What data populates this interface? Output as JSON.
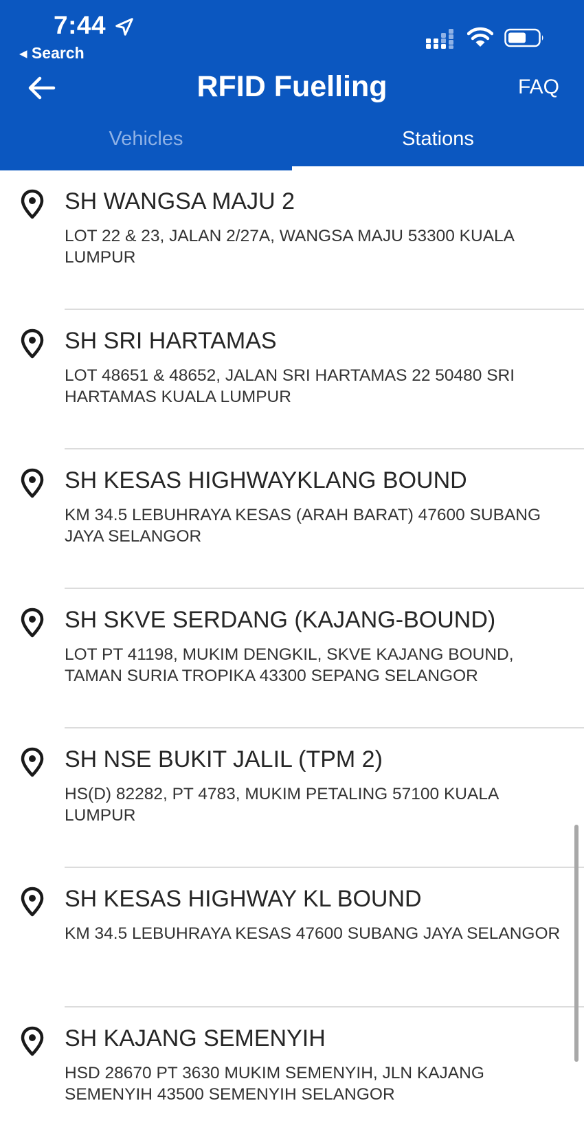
{
  "status_bar": {
    "time": "7:44",
    "back_app": "◂ Search"
  },
  "header": {
    "title": "RFID Fuelling",
    "faq_label": "FAQ",
    "brand_color": "#0b57c0"
  },
  "tabs": [
    {
      "label": "Vehicles",
      "active": false
    },
    {
      "label": "Stations",
      "active": true
    }
  ],
  "stations": [
    {
      "name": "SH WANGSA MAJU 2",
      "address": "LOT 22 & 23, JALAN 2/27A, WANGSA MAJU 53300 KUALA LUMPUR"
    },
    {
      "name": "SH SRI HARTAMAS",
      "address": "LOT 48651 & 48652, JALAN SRI HARTAMAS 22 50480 SRI HARTAMAS KUALA LUMPUR"
    },
    {
      "name": "SH KESAS HIGHWAYKLANG BOUND",
      "address": "KM 34.5 LEBUHRAYA KESAS (ARAH BARAT) 47600 SUBANG JAYA SELANGOR"
    },
    {
      "name": "SH SKVE SERDANG (KAJANG-BOUND)",
      "address": "LOT PT 41198, MUKIM DENGKIL, SKVE KAJANG BOUND, TAMAN SURIA TROPIKA 43300 SEPANG SELANGOR"
    },
    {
      "name": "SH NSE BUKIT JALIL (TPM 2)",
      "address": "HS(D) 82282, PT 4783, MUKIM PETALING 57100 KUALA LUMPUR"
    },
    {
      "name": "SH KESAS HIGHWAY KL BOUND",
      "address": "KM 34.5 LEBUHRAYA KESAS 47600 SUBANG JAYA SELANGOR"
    },
    {
      "name": "SH KAJANG SEMENYIH",
      "address": "HSD 28670 PT 3630 MUKIM SEMENYIH, JLN KAJANG SEMENYIH 43500 SEMENYIH SELANGOR"
    }
  ],
  "icons": {
    "back": "arrow-left-icon",
    "station": "location-pin-icon",
    "location_services": "location-arrow-icon",
    "signal": "cellular-signal-icon",
    "wifi": "wifi-icon",
    "battery": "battery-icon"
  }
}
